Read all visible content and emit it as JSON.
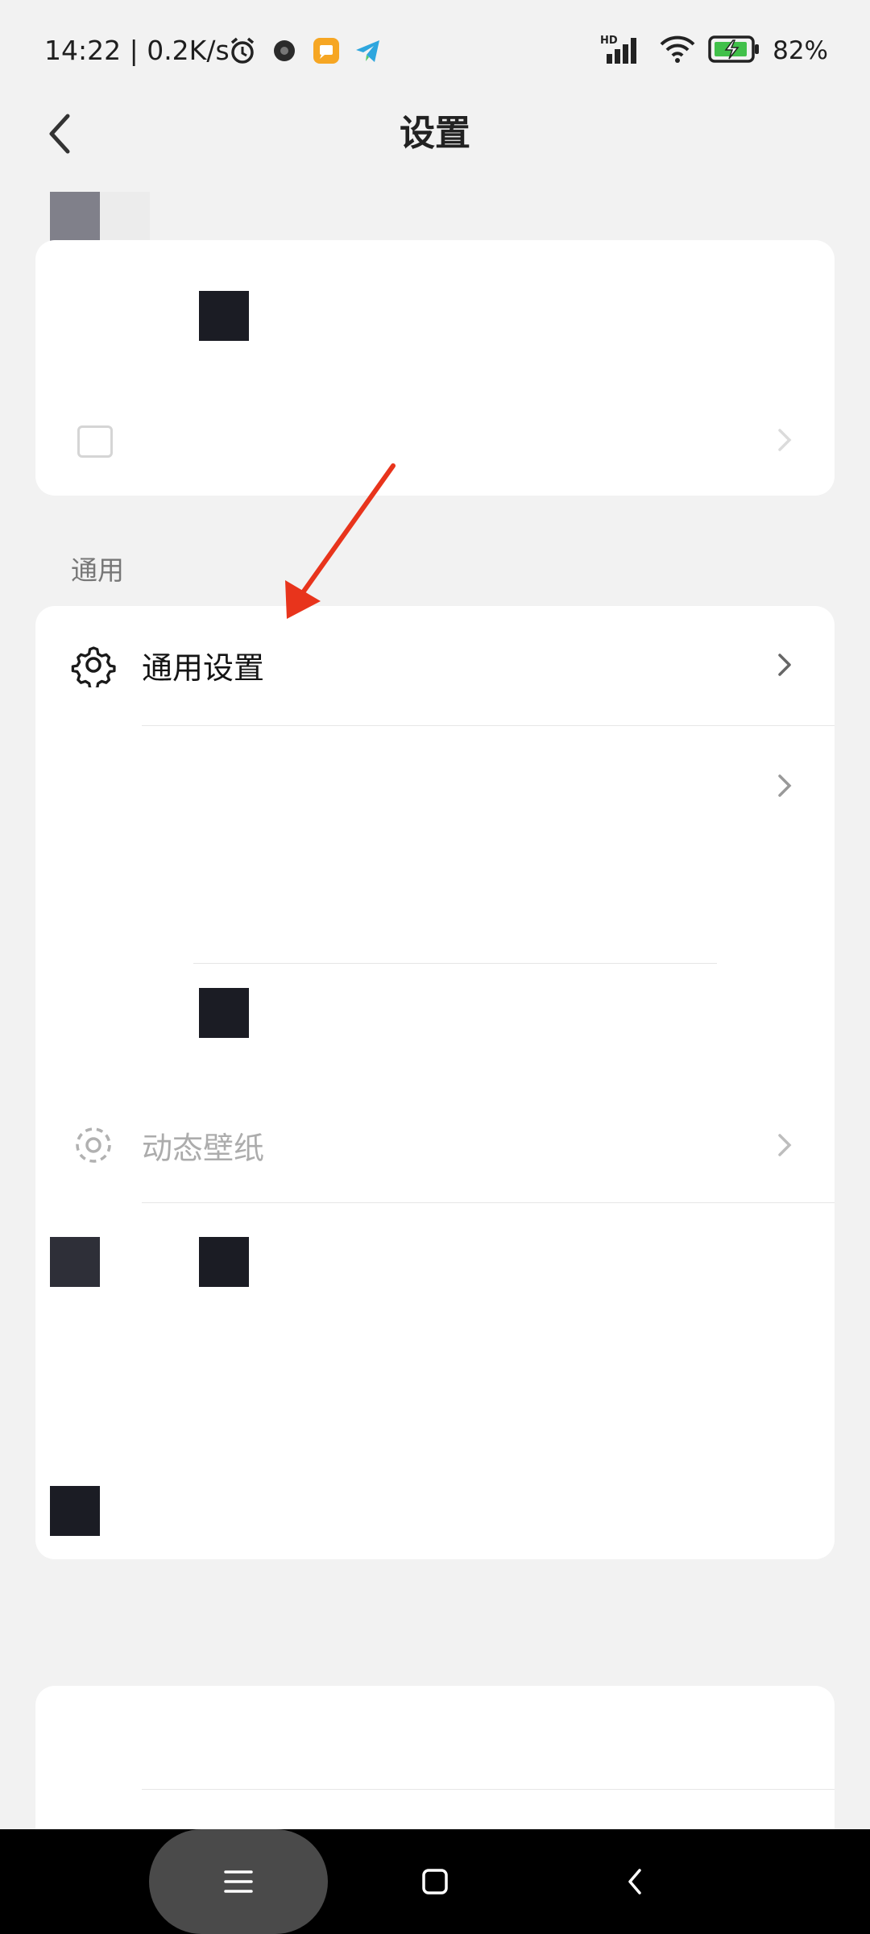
{
  "status_bar": {
    "time_speed": "14:22 | 0.2K/s",
    "network_label": "HD",
    "battery_percent": "82%",
    "icons": [
      "alarm-icon",
      "camera-app-icon",
      "message-app-icon",
      "telegram-icon",
      "signal-icon",
      "wifi-icon",
      "battery-charging-icon"
    ]
  },
  "header": {
    "back_icon": "chevron-left-icon",
    "title": "设置"
  },
  "general_section": {
    "label": "通用",
    "items": [
      {
        "icon": "gear-icon",
        "label": "通用设置"
      },
      {
        "icon": "",
        "label": ""
      },
      {
        "icon": "",
        "label": ""
      },
      {
        "icon": "live-wallpaper-icon",
        "label": "动态壁纸"
      }
    ]
  },
  "annotation": {
    "color": "#e8341c"
  },
  "navbar": {
    "icons": [
      "menu-icon",
      "home-square-icon",
      "back-chevron-icon"
    ]
  }
}
